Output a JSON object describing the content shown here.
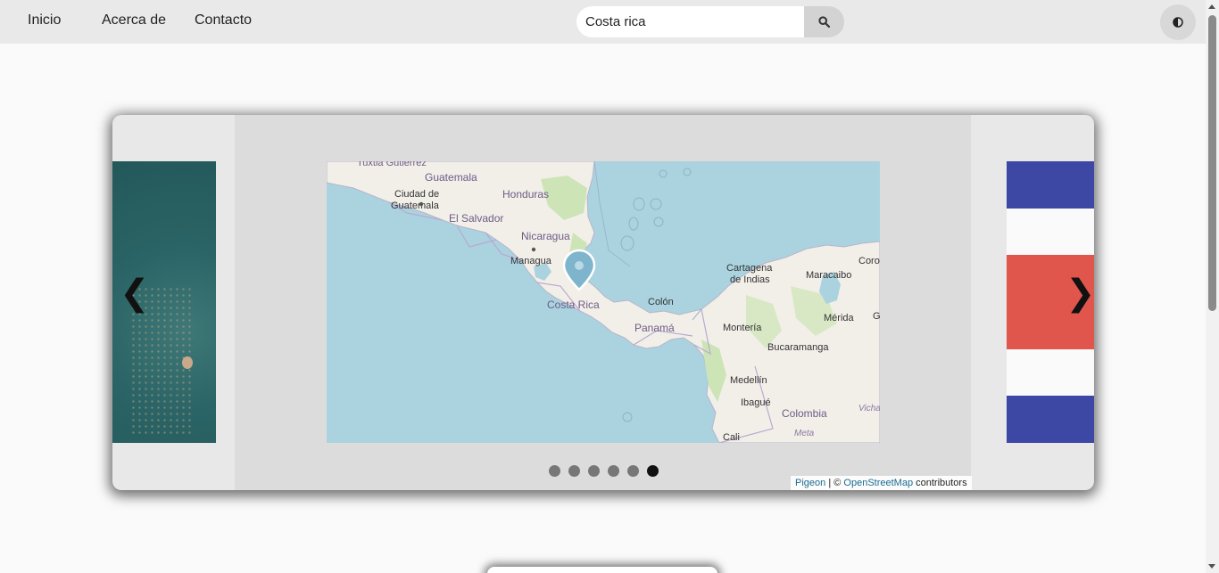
{
  "nav": {
    "links": [
      "Inicio",
      "Acerca de",
      "Contacto"
    ]
  },
  "search": {
    "value": "Costa rica",
    "placeholder": ""
  },
  "carousel": {
    "prev_arrow": "❮",
    "next_arrow": "❯",
    "slide_count": 6,
    "active_slide": 6,
    "map_labels": {
      "tuxtla": "Tuxtla Gutiérrez",
      "guatemala": "Guatemala",
      "ciudad_guatemala_1": "Ciudad de",
      "ciudad_guatemala_2": "Guatemala",
      "honduras": "Honduras",
      "el_salvador": "El Salvador",
      "nicaragua": "Nicaragua",
      "managua": "Managua",
      "costa_rica": "Costa Rica",
      "colon": "Colón",
      "panama": "Panamá",
      "cartagena_1": "Cartagena",
      "cartagena_2": "de Indias",
      "maracaibo": "Maracaibo",
      "coro": "Coro",
      "merida": "Mérida",
      "g": "G",
      "monteria": "Montería",
      "bucaramanga": "Bucaramanga",
      "medellin": "Medellín",
      "ibague": "Ibagué",
      "colombia": "Colombia",
      "meta": "Meta",
      "vichada": "Vicha",
      "cali": "Cali"
    },
    "attribution": {
      "pigeon": "Pigeon",
      "separator": " | © ",
      "osm": "OpenStreetMap",
      "suffix": " contributors"
    }
  },
  "colors": {
    "flag_blue": "#3c48a3",
    "flag_red": "#e0564d",
    "flag_white": "#fafafa",
    "water": "#aad3df",
    "land": "#f2efe9"
  }
}
